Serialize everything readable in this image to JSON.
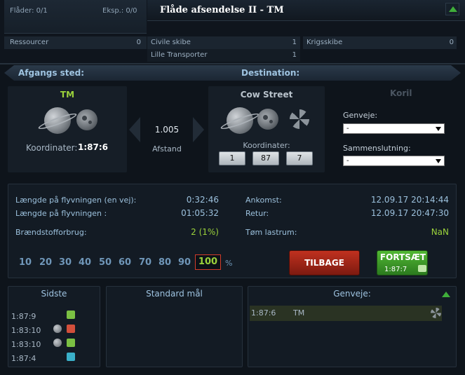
{
  "top": {
    "fleets": "Flåder: 0/1",
    "expeditions": "Eksp.: 0/0",
    "title": "Flåde afsendelse II - TM",
    "resources": {
      "label": "Ressourcer",
      "count": "0"
    },
    "civil": {
      "label": "Civile skibe",
      "count": "1"
    },
    "war": {
      "label": "Krigsskibe",
      "count": "0"
    },
    "small_transporter": {
      "label": "Lille Transporter",
      "count": "1"
    }
  },
  "origin": {
    "header": "Afgangs sted:",
    "name": "TM",
    "coord_label": "Koordinater:",
    "coord": "1:87:6"
  },
  "distance": {
    "value": "1.005",
    "label": "Afstand"
  },
  "destination": {
    "header": "Destination:",
    "name": "Cow Street",
    "coord_label": "Koordinater:",
    "galaxy": "1",
    "system": "87",
    "position": "7",
    "other_name": "Koril"
  },
  "shortcuts_select": {
    "label": "Genveje:",
    "value": "-"
  },
  "union_select": {
    "label": "Sammenslutning:",
    "value": "-"
  },
  "info": {
    "flight_oneway_label": "Længde på flyvningen (en vej):",
    "flight_oneway": "0:32:46",
    "flight_total_label": "Længde på flyvningen :",
    "flight_total": "01:05:32",
    "fuel_label": "Brændstofforbrug:",
    "fuel": "2 (1%)",
    "arrival_label": "Ankomst:",
    "arrival": "12.09.17 20:14:44",
    "return_label": "Retur:",
    "return": "12.09.17 20:47:30",
    "cargo_label": "Tøm lastrum:",
    "cargo": "NaN"
  },
  "speed": {
    "options": [
      "10",
      "20",
      "30",
      "40",
      "50",
      "60",
      "70",
      "80",
      "90"
    ],
    "selected": "100",
    "unit": "%"
  },
  "buttons": {
    "back": "TILBAGE",
    "next": "FORTSÆT",
    "next_coord": "1:87:7"
  },
  "recent": {
    "title": "Sidste",
    "items": [
      "1:87:9",
      "1:83:10",
      "1:83:10",
      "1:87:4"
    ]
  },
  "standard": {
    "title": "Standard mål"
  },
  "shortcuts": {
    "title": "Genveje:",
    "items": [
      {
        "coord": "1:87:6",
        "name": "TM"
      }
    ]
  },
  "colors": {
    "accent_green": "#9bd23b",
    "header_blue": "#9ec3e0",
    "danger_red": "#c0311f"
  }
}
